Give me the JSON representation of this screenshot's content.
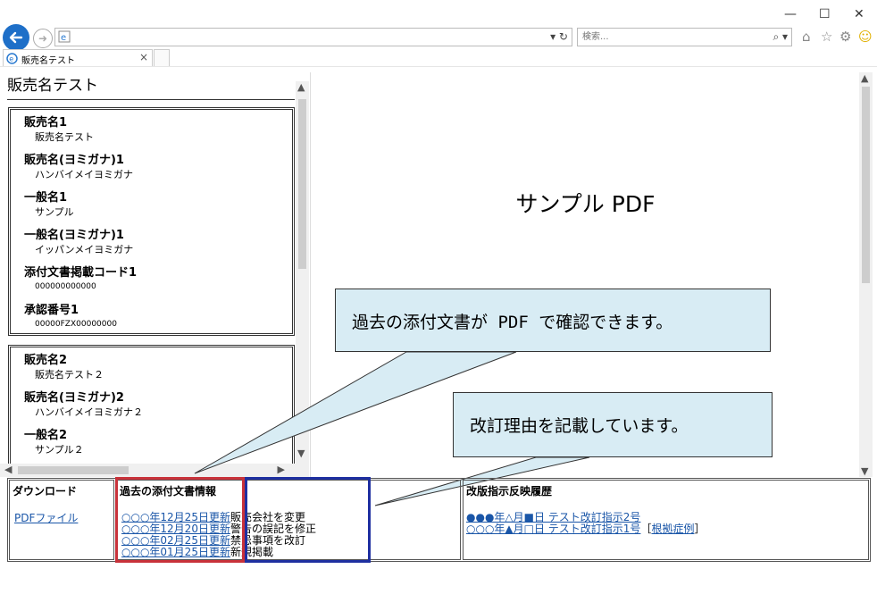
{
  "browser": {
    "address_url": "",
    "search_placeholder": "検索...",
    "tab_title": "販売名テスト",
    "window_controls": [
      "minimize-icon",
      "maximize-icon",
      "close-icon"
    ],
    "toolbar_icons": [
      "home-icon",
      "star-icon",
      "gear-icon",
      "smiley-icon"
    ]
  },
  "left": {
    "page_title": "販売名テスト",
    "card1": [
      {
        "label": "販売名1",
        "value": "販売名テスト"
      },
      {
        "label": "販売名(ヨミガナ)1",
        "value": "ハンバイメイヨミガナ"
      },
      {
        "label": "一般名1",
        "value": "サンプル"
      },
      {
        "label": "一般名(ヨミガナ)1",
        "value": "イッパンメイヨミガナ"
      },
      {
        "label": "添付文書掲載コード1",
        "value": "000000000000"
      },
      {
        "label": "承認番号1",
        "value": "00000FZX00000000"
      }
    ],
    "card2": [
      {
        "label": "販売名2",
        "value": "販売名テスト２"
      },
      {
        "label": "販売名(ヨミガナ)2",
        "value": "ハンバイメイヨミガナ２"
      },
      {
        "label": "一般名2",
        "value": "サンプル２"
      }
    ]
  },
  "pdf": {
    "title": "サンプル PDF"
  },
  "callouts": {
    "c1": "過去の添付文書が PDF で確認できます。",
    "c2": "改訂理由を記載しています。"
  },
  "table": {
    "download_header": "ダウンロード",
    "download_link": "PDFファイル",
    "history_header": "過去の添付文書情報",
    "history": [
      {
        "date": "○○○年12月25日更新",
        "note": "販売会社を変更"
      },
      {
        "date": "○○○年12月20日更新",
        "note": "警告の誤記を修正"
      },
      {
        "date": "○○○年02月25日更新",
        "note": "禁忌事項を改訂"
      },
      {
        "date": "○○○年01月25日更新",
        "note": "新規掲載"
      }
    ],
    "revision_header": "改版指示反映履歴",
    "revisions": [
      {
        "link": "●●●年△月■日 テスト改訂指示2号",
        "extra_pre": "",
        "extra_link": "",
        "extra_post": ""
      },
      {
        "link": "○○○年▲月□日 テスト改訂指示1号",
        "extra_pre": "［",
        "extra_link": "根拠症例",
        "extra_post": "］"
      }
    ]
  },
  "colors": {
    "back_button": "#1e6fc8",
    "link": "#1a56a8",
    "callout_fill": "#d8ecf4",
    "highlight_red": "#c8323a",
    "highlight_blue": "#1e2fa0"
  }
}
